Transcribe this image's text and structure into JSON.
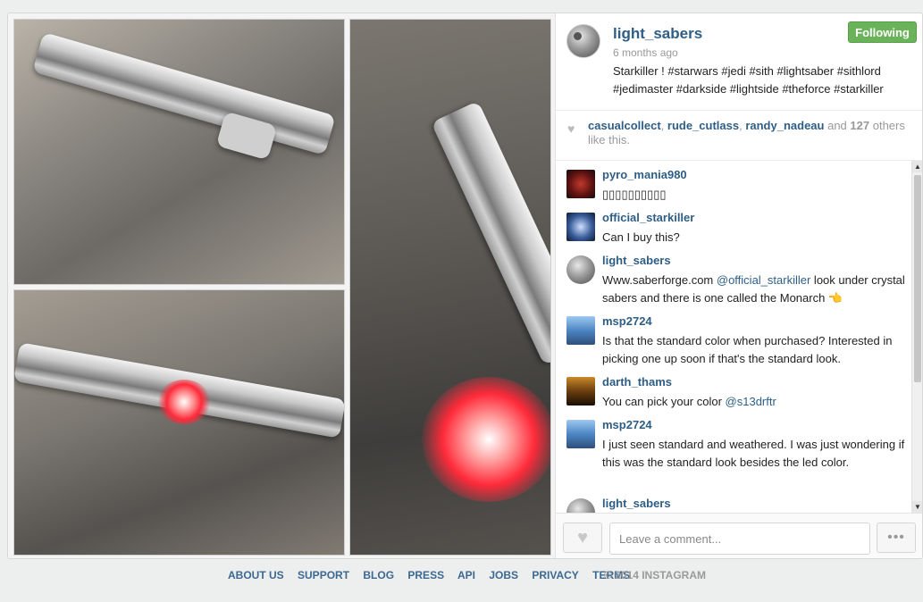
{
  "post": {
    "username": "light_sabers",
    "time": "6 months ago",
    "caption": "Starkiller ! #starwars #jedi #sith #lightsaber #sithlord #jedimaster #darkside #lightside #theforce #starkiller",
    "follow_label": "Following"
  },
  "likes": {
    "users": [
      "casualcollect",
      "rude_cutlass",
      "randy_nadeau"
    ],
    "sep1": ", ",
    "sep2": ", ",
    "and": " and ",
    "count": "127",
    "suffix": " others like this."
  },
  "comments": [
    {
      "user": "pyro_mania980",
      "text": "▯▯▯▯▯▯▯▯▯▯"
    },
    {
      "user": "official_starkiller",
      "text": "Can I buy this?"
    },
    {
      "user": "light_sabers",
      "text_pre": "Www.saberforge.com ",
      "mention": "@official_starkiller",
      "text_post": " look under crystal sabers and there is one called the Monarch 👈"
    },
    {
      "user": "msp2724",
      "text": "Is that the standard color when purchased? Interested in picking one up soon if that's the standard look."
    },
    {
      "user": "darth_thams",
      "text_pre": "You can pick your color ",
      "mention": "@s13drftr"
    },
    {
      "user": "msp2724",
      "text": "I just seen standard and weathered. I was just wondering if this was the standard look besides the led color."
    },
    {
      "user": "light_sabers",
      "text": ""
    }
  ],
  "comment_box": {
    "placeholder": "Leave a comment...",
    "more": "•••",
    "like": "♥"
  },
  "scroll": {
    "up": "▲",
    "down": "▼"
  },
  "footer": {
    "links": [
      "ABOUT US",
      "SUPPORT",
      "BLOG",
      "PRESS",
      "API",
      "JOBS",
      "PRIVACY",
      "TERMS"
    ],
    "copyright": "© 2014 INSTAGRAM"
  },
  "colors": {
    "link": "#2e5e86",
    "follow_green": "#6bb35a",
    "background": "#edeeee"
  },
  "icons": {
    "heart": "heart-icon",
    "more": "more-dots-icon"
  }
}
